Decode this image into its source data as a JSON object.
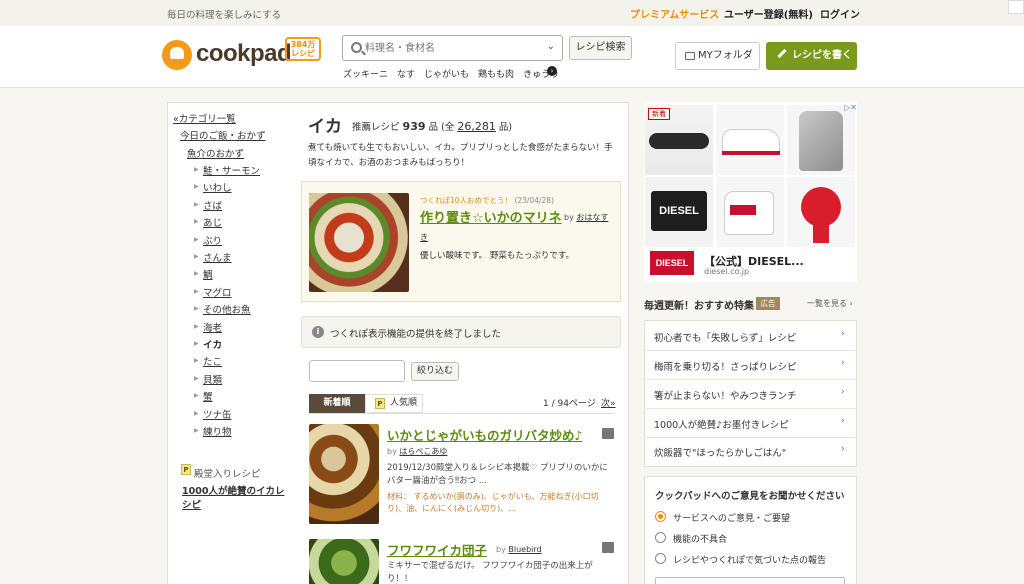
{
  "topbar": {
    "tagline": "毎日の料理を楽しみにする",
    "premium": "プレミアムサービス",
    "register": "ユーザー登録(無料)",
    "login": "ログイン"
  },
  "header": {
    "logo_text": "cookpad",
    "recipe_count_line1": "384万",
    "recipe_count_line2": "レシピ",
    "search_placeholder": "料理名・食材名",
    "search_button": "レシピ検索",
    "keywords": [
      "ズッキーニ",
      "なす",
      "じゃがいも",
      "鶏もも肉",
      "きゅうり"
    ],
    "myfolder": "MYフォルダ",
    "write_recipe": "レシピを書く"
  },
  "sidebar": {
    "category_list": "«カテゴリ一覧",
    "parent1": "今日のご飯・おかず",
    "parent2": "魚介のおかず",
    "items": [
      "鮭・サーモン",
      "いわし",
      "さば",
      "あじ",
      "ぶり",
      "さんま",
      "鯛",
      "マグロ",
      "その他お魚",
      "海老",
      "イカ",
      "たこ",
      "貝類",
      "蟹",
      "ツナ缶",
      "練り物"
    ],
    "hall_of_fame_label": "殿堂入りレシピ",
    "hall_of_fame_link": "1000人が絶賛のイカレシピ",
    "premium_mark": "P"
  },
  "main": {
    "title": "イカ",
    "stats_label": "推薦レシピ",
    "stats_count": "939",
    "stats_unit": "品",
    "stats_total_prefix": "(全",
    "stats_total": "26,281",
    "stats_total_suffix": "品)",
    "description": "煮ても焼いても生でもおいしい、イカ。プリプリっとした食感がたまらない！手頃なイカで、お酒のおつまみもばっちり！",
    "featured": {
      "note": "つくれぽ10人おめでとう！",
      "date": "(23/04/28)",
      "title": "作り置き☆いかのマリネ",
      "by": "by",
      "author_part1": "おはなす",
      "author_part2": "き",
      "desc": "優しい酸味です。 野菜もたっぷりです。"
    },
    "notice": "つくれぽ表示機能の提供を終了しました",
    "filter_button": "絞り込む",
    "sort_new": "新着順",
    "sort_popular": "人気順",
    "pagination": "1 / 94ページ",
    "page_next": "次»",
    "recipes": [
      {
        "title": "いかとじゃがいものガリバタ炒め♪",
        "by": "by",
        "author": "はらぺこあゆ",
        "desc": "2019/12/30殿堂入り＆レシピ本掲載♡ プリプリのいかにバター醤油が合う‼おつ ...",
        "ingredients": "材料： するめいか(胴のみ)、じゃがいも、万能ねぎ(小口切り)、油、にんにく(みじん切り)、..."
      },
      {
        "title": "フワフワイカ団子",
        "by": "by",
        "author": "Bluebird",
        "desc": "ミキサーで混ぜるだけ。 フワフワイカ団子の出来上がり！！"
      }
    ]
  },
  "ad": {
    "new_tag": "新着",
    "choices_label": "▷✕",
    "brand_logo": "DIESEL",
    "title": "【公式】DIESEL...",
    "domain": "diesel.co.jp"
  },
  "weekly": {
    "title": "毎週更新！おすすめ特集",
    "ad_tag": "広告",
    "see_all": "一覧を見る",
    "items": [
      "初心者でも「失敗しらず」レシピ",
      "梅雨を乗り切る！さっぱりレシピ",
      "箸が止まらない！やみつきランチ",
      "1000人が絶賛♪お墨付きレシピ",
      "炊飯器で\"ほったらかしごはん\""
    ]
  },
  "feedback": {
    "title": "クックパッドへのご意見をお聞かせください",
    "options": [
      "サービスへのご意見・ご要望",
      "機能の不具合",
      "レシピやつくれぽで気づいた点の報告"
    ]
  },
  "colors": {
    "brand_orange": "#f39a1b",
    "link_green": "#5d8a10",
    "write_button": "#7a9a1e",
    "ad_tag": "#a0885e"
  }
}
